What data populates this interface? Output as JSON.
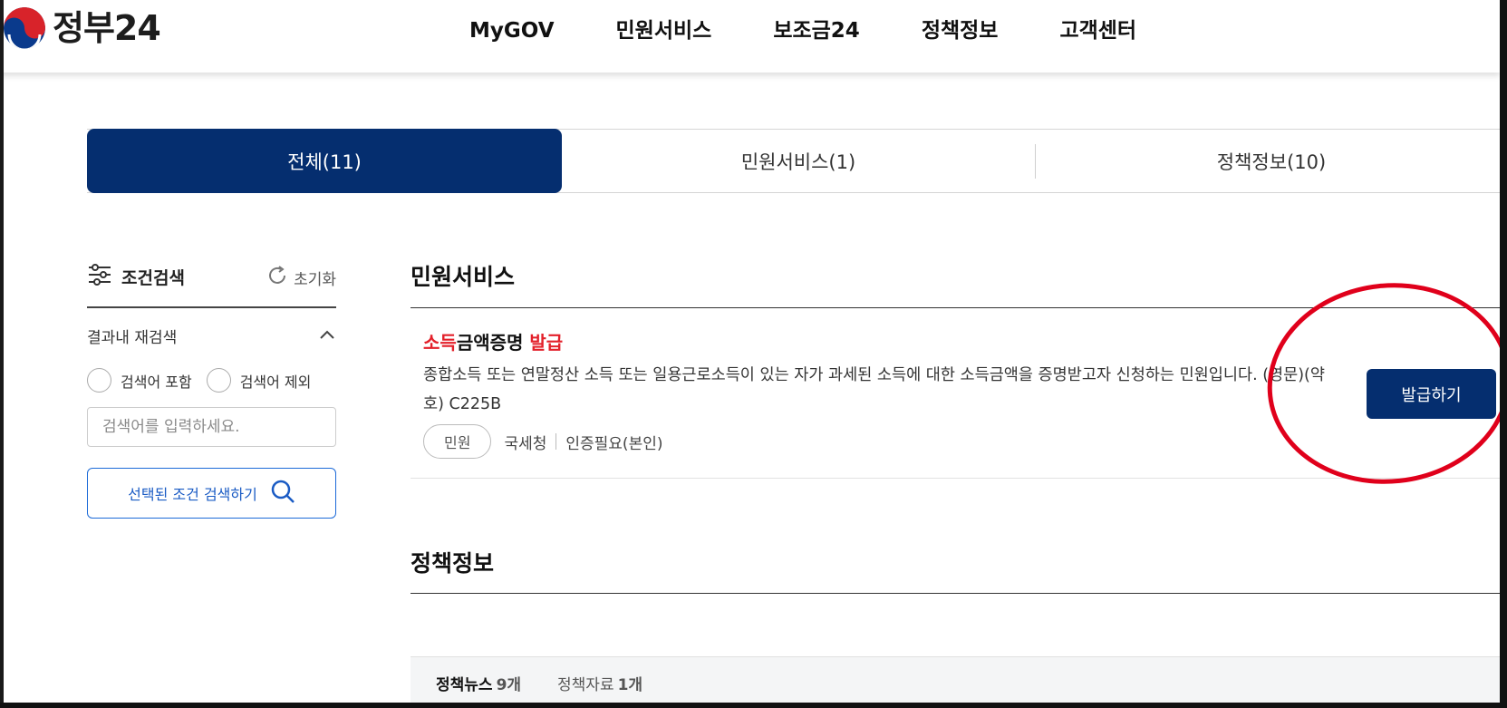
{
  "header": {
    "logo_text": "정부24",
    "nav": [
      "MyGOV",
      "민원서비스",
      "보조금24",
      "정책정보",
      "고객센터"
    ]
  },
  "tabs": [
    {
      "label": "전체(11)",
      "active": true
    },
    {
      "label": "민원서비스(1)",
      "active": false
    },
    {
      "label": "정책정보(10)",
      "active": false
    }
  ],
  "sidebar": {
    "filter_title": "조건검색",
    "reset_label": "초기화",
    "research_label": "결과내 재검색",
    "radio_include": "검색어 포함",
    "radio_exclude": "검색어 제외",
    "search_placeholder": "검색어를 입력하세요.",
    "search_button": "선택된 조건 검색하기"
  },
  "main": {
    "section1_title": "민원서비스",
    "result": {
      "title_hl1": "소득",
      "title_mid": "금액증명 ",
      "title_hl2": "발급",
      "desc": "종합소득 또는 연말정산 소득 또는 일용근로소득이 있는 자가 과세된 소득에 대한 소득금액을 증명받고자 신청하는 민원입니다. (영문)(약호) C225B",
      "badge": "민원",
      "org": "국세청",
      "auth": "인증필요(본인)",
      "button": "발급하기"
    },
    "section2_title": "정책정보",
    "subtabs": [
      {
        "name": "정책뉴스",
        "count": "9개",
        "active": true
      },
      {
        "name": "정책자료",
        "count": "1개",
        "active": false
      }
    ]
  },
  "colors": {
    "primary": "#052e6f",
    "highlight": "#e3202a",
    "annotation": "#e0001b",
    "link_blue": "#1a5bc4"
  }
}
